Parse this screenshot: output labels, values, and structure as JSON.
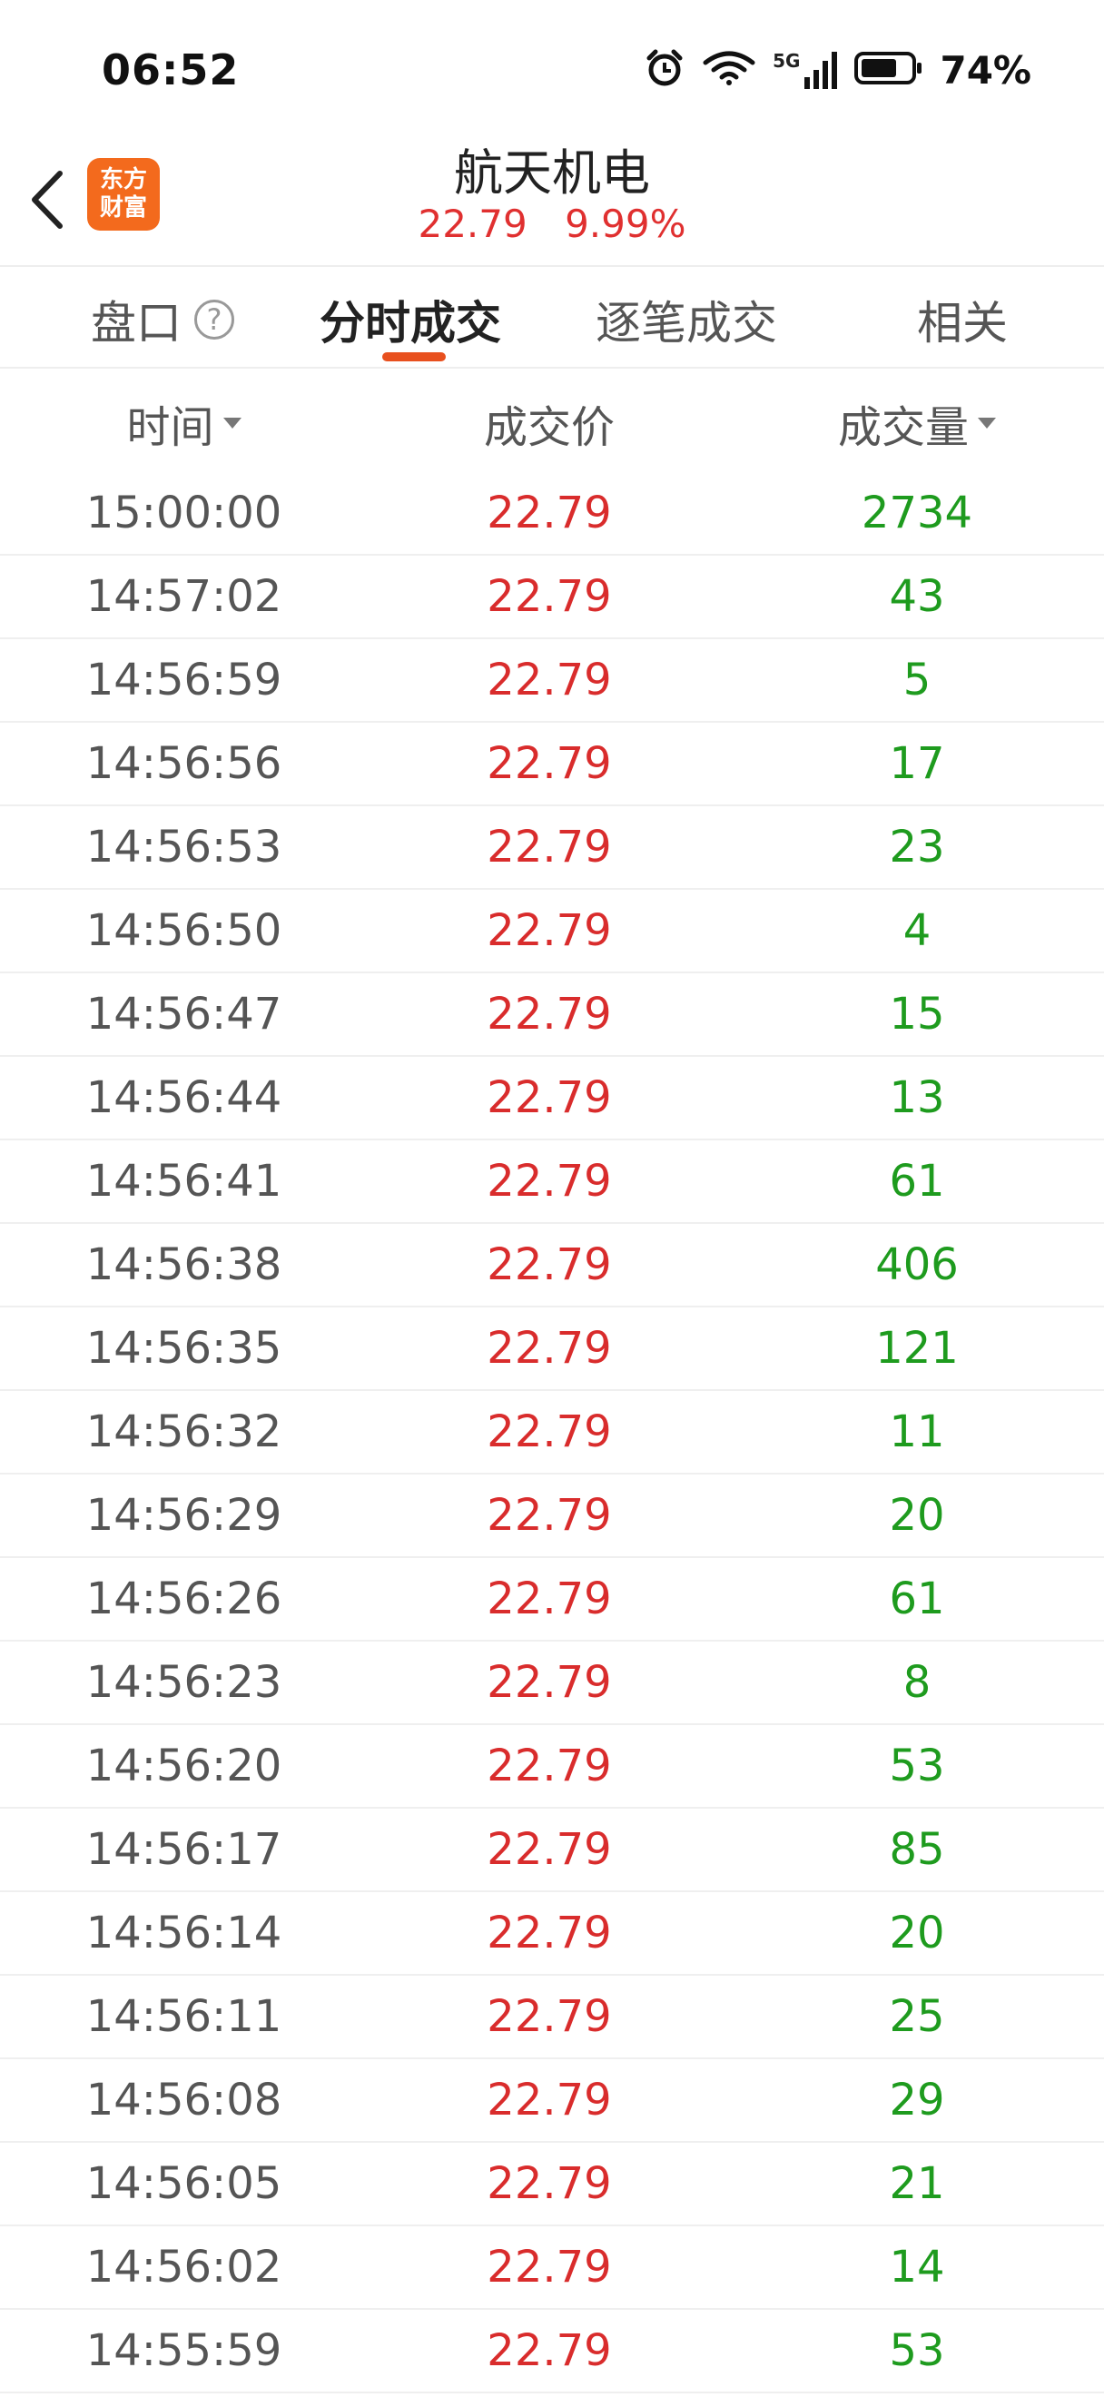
{
  "status_bar": {
    "time": "06:52",
    "battery": "74%",
    "network": "5G"
  },
  "header": {
    "logo_line1": "东方",
    "logo_line2": "财富",
    "stock_name": "航天机电",
    "price": "22.79",
    "change_pct": "9.99%"
  },
  "tabs": [
    {
      "label": "盘口"
    },
    {
      "label": "分时成交"
    },
    {
      "label": "逐笔成交"
    },
    {
      "label": "相关"
    }
  ],
  "columns": {
    "time": "时间",
    "price": "成交价",
    "volume": "成交量"
  },
  "colors": {
    "up_red": "#d92c2c",
    "volume_green": "#1e9b1e",
    "brand_orange": "#f36a1d"
  },
  "trades": [
    {
      "time": "15:00:00",
      "price": "22.79",
      "volume": "2734"
    },
    {
      "time": "14:57:02",
      "price": "22.79",
      "volume": "43"
    },
    {
      "time": "14:56:59",
      "price": "22.79",
      "volume": "5"
    },
    {
      "time": "14:56:56",
      "price": "22.79",
      "volume": "17"
    },
    {
      "time": "14:56:53",
      "price": "22.79",
      "volume": "23"
    },
    {
      "time": "14:56:50",
      "price": "22.79",
      "volume": "4"
    },
    {
      "time": "14:56:47",
      "price": "22.79",
      "volume": "15"
    },
    {
      "time": "14:56:44",
      "price": "22.79",
      "volume": "13"
    },
    {
      "time": "14:56:41",
      "price": "22.79",
      "volume": "61"
    },
    {
      "time": "14:56:38",
      "price": "22.79",
      "volume": "406"
    },
    {
      "time": "14:56:35",
      "price": "22.79",
      "volume": "121"
    },
    {
      "time": "14:56:32",
      "price": "22.79",
      "volume": "11"
    },
    {
      "time": "14:56:29",
      "price": "22.79",
      "volume": "20"
    },
    {
      "time": "14:56:26",
      "price": "22.79",
      "volume": "61"
    },
    {
      "time": "14:56:23",
      "price": "22.79",
      "volume": "8"
    },
    {
      "time": "14:56:20",
      "price": "22.79",
      "volume": "53"
    },
    {
      "time": "14:56:17",
      "price": "22.79",
      "volume": "85"
    },
    {
      "time": "14:56:14",
      "price": "22.79",
      "volume": "20"
    },
    {
      "time": "14:56:11",
      "price": "22.79",
      "volume": "25"
    },
    {
      "time": "14:56:08",
      "price": "22.79",
      "volume": "29"
    },
    {
      "time": "14:56:05",
      "price": "22.79",
      "volume": "21"
    },
    {
      "time": "14:56:02",
      "price": "22.79",
      "volume": "14"
    },
    {
      "time": "14:55:59",
      "price": "22.79",
      "volume": "53"
    }
  ]
}
